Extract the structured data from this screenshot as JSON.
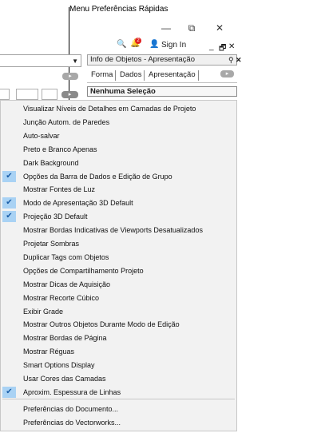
{
  "callout": {
    "label": "Menu Preferências Rápidas"
  },
  "window": {
    "minimize": "—",
    "restore": "⧉",
    "close": "✕"
  },
  "toolbar": {
    "search_icon": "🔍",
    "notification_count": "2",
    "user_icon": "👤",
    "sign_in": "Sign In",
    "panel_min": "_",
    "panel_float": "🗗",
    "panel_close": "✕"
  },
  "object_info": {
    "title": "Info de Objetos - Apresentação",
    "pin": "⚲",
    "close": "✕",
    "tabs": [
      "Forma",
      "Dados",
      "Apresentação"
    ],
    "selection": "Nenhuma Seleção"
  },
  "menu": {
    "items": [
      {
        "label": "Visualizar Níveis de Detalhes em Camadas de Projeto",
        "checked": false
      },
      {
        "label": "Junção Autom. de Paredes",
        "checked": false
      },
      {
        "label": "Auto-salvar",
        "checked": false
      },
      {
        "label": "Preto e Branco Apenas",
        "checked": false
      },
      {
        "label": "Dark Background",
        "checked": false
      },
      {
        "label": "Opções da Barra de Dados e Edição de Grupo",
        "checked": true
      },
      {
        "label": "Mostrar Fontes de Luz",
        "checked": false
      },
      {
        "label": "Modo de Apresentação 3D Default",
        "checked": true
      },
      {
        "label": "Projeção 3D Default",
        "checked": true
      },
      {
        "label": "Mostrar Bordas Indicativas de Viewports Desatualizados",
        "checked": false
      },
      {
        "label": "Projetar Sombras",
        "checked": false
      },
      {
        "label": "Duplicar Tags com Objetos",
        "checked": false
      },
      {
        "label": "Opções de Compartilhamento Projeto",
        "checked": false
      },
      {
        "label": "Mostrar Dicas de Aquisição",
        "checked": false
      },
      {
        "label": "Mostrar Recorte Cúbico",
        "checked": false
      },
      {
        "label": "Exibir Grade",
        "checked": false
      },
      {
        "label": "Mostrar Outros Objetos Durante Modo de Edição",
        "checked": false
      },
      {
        "label": "Mostrar Bordas de Página",
        "checked": false
      },
      {
        "label": "Mostrar Réguas",
        "checked": false
      },
      {
        "label": "Smart Options Display",
        "checked": false
      },
      {
        "label": "Usar Cores das Camadas",
        "checked": false
      },
      {
        "label": "Aproxim. Espessura de Linhas",
        "checked": true
      }
    ],
    "footer_items": [
      {
        "label": "Preferências do Documento..."
      },
      {
        "label": "Preferências do Vectorworks..."
      }
    ]
  },
  "colors": {
    "check_highlight": "#a9d2f4",
    "badge": "#e02020",
    "menu_bg": "#f2f2f2"
  }
}
